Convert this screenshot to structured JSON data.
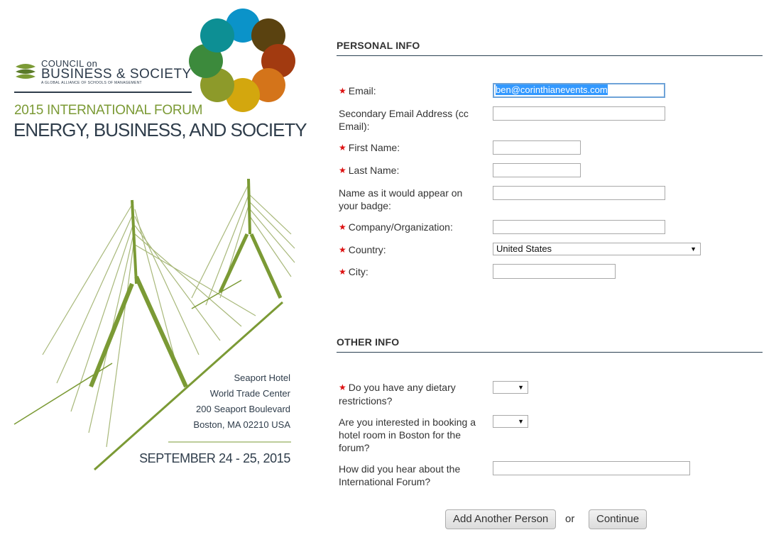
{
  "poster": {
    "council": "COUNCIL on",
    "org_name": "BUSINESS & SOCIETY",
    "org_tagline": "A GLOBAL ALLIANCE OF SCHOOLS OF MANAGEMENT",
    "forum_year": "2015 INTERNATIONAL FORUM",
    "forum_title": "ENERGY, BUSINESS, AND SOCIETY",
    "venue_lines": [
      "Seaport Hotel",
      "World Trade Center",
      "200 Seaport Boulevard",
      "Boston, MA 02210 USA"
    ],
    "dates": "SEPTEMBER 24 - 25, 2015",
    "petal_colors": [
      "#0b93c9",
      "#5a4210",
      "#a23a10",
      "#d4741a",
      "#d3a70e",
      "#8d9a2a",
      "#3c8a3c",
      "#0d8f94"
    ],
    "accent_green": "#7b9a35"
  },
  "personal": {
    "title": "PERSONAL INFO",
    "email_label": "Email:",
    "email_value": "ben@corinthianevents.com",
    "secondary_email_label": "Secondary Email Address (cc Email):",
    "first_name_label": "First Name:",
    "last_name_label": "Last Name:",
    "badge_label": "Name as it would appear on your badge:",
    "company_label": "Company/Organization:",
    "country_label": "Country:",
    "country_value": "United States",
    "city_label": "City:"
  },
  "other": {
    "title": "OTHER INFO",
    "dietary_label": "Do you have any dietary restrictions?",
    "hotel_label": "Are you interested in booking a hotel room in Boston for the forum?",
    "hear_label": "How did you hear about the International Forum?"
  },
  "actions": {
    "add_person": "Add Another Person",
    "or": "or",
    "continue": "Continue"
  },
  "icons": {
    "required": "red-asterisk-icon",
    "dropdown": "chevron-down-icon"
  }
}
